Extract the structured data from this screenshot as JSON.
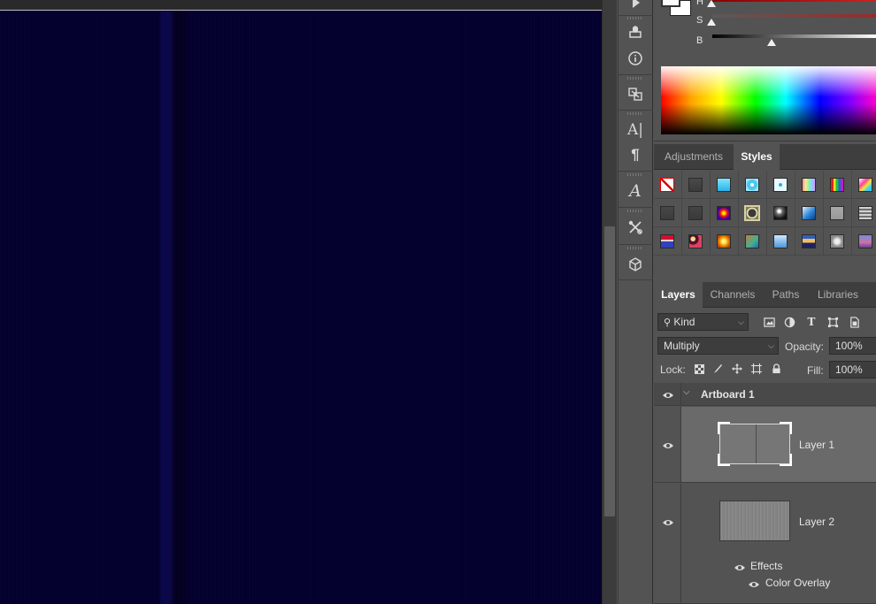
{
  "color_panel": {
    "h_label": "H",
    "s_label": "S",
    "b_label": "B",
    "hsb_levels": {
      "h": 0.0,
      "s": 0.0,
      "b": 0.36
    },
    "foreground_color": "#ffffff",
    "background_color": "#ffffff"
  },
  "style_tabs": {
    "adjustments": "Adjustments",
    "styles": "Styles",
    "active": "Styles"
  },
  "style_presets": [
    "none",
    "dark-gray",
    "cyan",
    "cyan-frame",
    "light-cyan-frame",
    "pastel-rainbow",
    "rainbow-stripes",
    "prism",
    "dark-square",
    "dark-square-2",
    "fire-sun",
    "gold-bevel",
    "chrome-ball",
    "blue-glass",
    "light-gray",
    "striped-gray",
    "red-blue-stripes",
    "camo-paint",
    "gold-burst",
    "teal-green",
    "sky-blue",
    "sunset",
    "gray-texture",
    "purple-fade"
  ],
  "layer_tabs": {
    "layers": "Layers",
    "channels": "Channels",
    "paths": "Paths",
    "libraries": "Libraries",
    "active": "Layers"
  },
  "layers_panel": {
    "filter_kind": "Kind",
    "blend_mode": "Multiply",
    "opacity_label": "Opacity:",
    "opacity_value": "100%",
    "lock_label": "Lock:",
    "fill_label": "Fill:",
    "fill_value": "100%"
  },
  "layers": {
    "artboard": "Artboard 1",
    "layer1": "Layer 1",
    "layer2": "Layer 2",
    "effects": "Effects",
    "color_overlay": "Color Overlay"
  },
  "icons": {
    "strip": [
      "play-icon",
      "3d-print-icon",
      "info-icon",
      "clone-source-icon",
      "character-icon",
      "paragraph-icon",
      "glyphs-icon",
      "tool-presets-icon",
      "3d-icon"
    ]
  },
  "colors": {
    "canvas_fill": "#04002e",
    "panel_bg": "#535353",
    "selected_layer_bg": "#6a6a6a"
  }
}
